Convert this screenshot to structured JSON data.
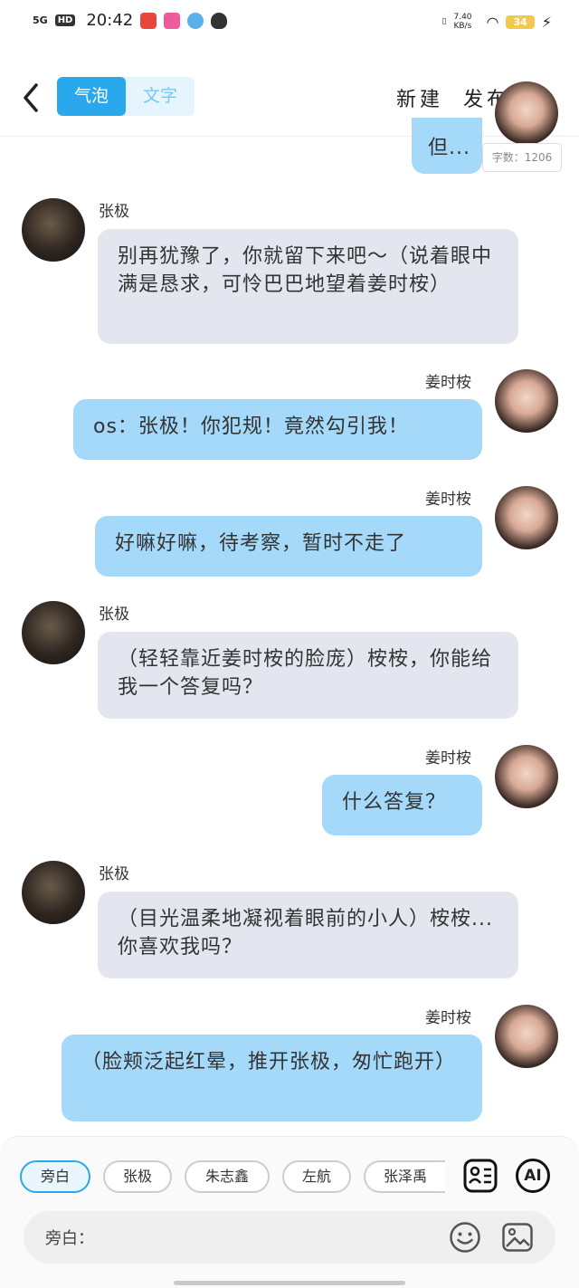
{
  "status": {
    "network": "5G",
    "hd": "HD",
    "time": "20:42",
    "speed": "7.40 KB/s",
    "battery": "34"
  },
  "header": {
    "tab_bubble": "气泡",
    "tab_text": "文字",
    "new_label": "新建",
    "publish_label": "发布"
  },
  "char_count": "字数：1206",
  "partial_bubble": "但...",
  "messages": [
    {
      "speaker": "张极",
      "text": "别再犹豫了，你就留下来吧～（说着眼中满是恳求，可怜巴巴地望着姜时桉）"
    },
    {
      "speaker": "姜时桉",
      "text": "os：张极！你犯规！竟然勾引我！"
    },
    {
      "speaker": "姜时桉",
      "text": "好嘛好嘛，待考察，暂时不走了"
    },
    {
      "speaker": "张极",
      "text": "（轻轻靠近姜时桉的脸庞）桉桉，你能给我一个答复吗？"
    },
    {
      "speaker": "姜时桉",
      "text": "什么答复？"
    },
    {
      "speaker": "张极",
      "text": "（目光温柔地凝视着眼前的小人）桉桉...你喜欢我吗？"
    },
    {
      "speaker": "姜时桉",
      "text": "（脸颊泛起红晕，推开张极，匆忙跑开）"
    }
  ],
  "roles": [
    "旁白",
    "张极",
    "朱志鑫",
    "左航",
    "张泽禹"
  ],
  "tools": {
    "ai_label": "AI"
  },
  "input": {
    "label": "旁白："
  },
  "colors": {
    "accent": "#29a8eb",
    "bubble_right": "#a4d9fa",
    "bubble_left": "#e3e6ee"
  }
}
